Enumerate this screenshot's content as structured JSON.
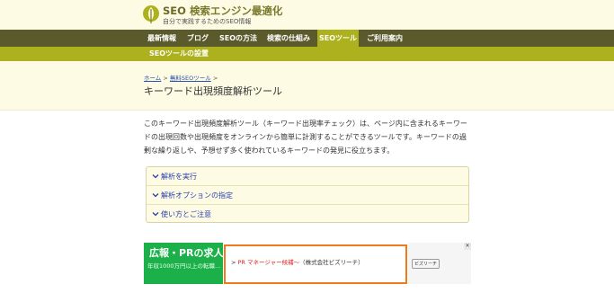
{
  "site": {
    "title_seo": "SEO",
    "title_rest": "検索エンジン最適化",
    "tagline": "自分で実践するためのSEO情報"
  },
  "nav": {
    "items": [
      {
        "label": "最新情報"
      },
      {
        "label": "ブログ"
      },
      {
        "label": "SEOの方法"
      },
      {
        "label": "検索の仕組み"
      },
      {
        "label": "SEOツール",
        "active": true
      },
      {
        "label": "ご利用案内"
      }
    ],
    "subnav_label": "SEOツールの設置"
  },
  "breadcrumb": {
    "home": "ホーム",
    "sep1": " > ",
    "tools": "無料SEOツール",
    "sep2": " >"
  },
  "page_title": "キーワード出現頻度解析ツール",
  "description": "このキーワード出現頻度解析ツール（キーワード出現率チェック）は、ページ内に含まれるキーワードの出現回数や出現頻度をオンラインから簡単に計測することができるツールです。キーワードの過剰な繰り返しや、予想せず多く使われているキーワードの発見に役立ちます。",
  "accordion": {
    "items": [
      {
        "label": "解析を実行"
      },
      {
        "label": "解析オプションの指定"
      },
      {
        "label": "使い方とご注意"
      }
    ]
  },
  "ad": {
    "title": "広報・PRの求人",
    "subtitle": "年収1000万円以上の転職...",
    "arrow": "> ",
    "job": "PR マネージャー候補～",
    "company": "（株式会社ビズリーチ）",
    "brand": "ビズリーチ",
    "close": "✕"
  },
  "colors": {
    "nav_bg": "#5a5a2c",
    "accent": "#aeb11e",
    "header_bg": "#fdfbe4",
    "link": "#2a3fa8",
    "ad_green": "#1bb04a",
    "ad_orange": "#f07a1a"
  }
}
